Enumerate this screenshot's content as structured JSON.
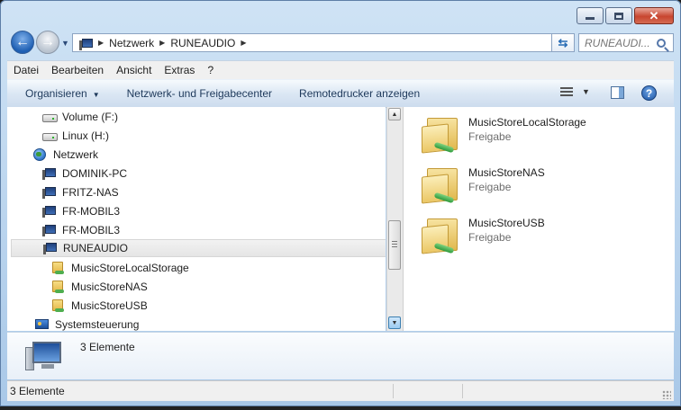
{
  "address": {
    "segments": [
      "Netzwerk",
      "RUNEAUDIO"
    ],
    "search_placeholder": "RUNEAUDI..."
  },
  "menubar": [
    "Datei",
    "Bearbeiten",
    "Ansicht",
    "Extras",
    "?"
  ],
  "toolbar": {
    "organize_label": "Organisieren",
    "network_center_label": "Netzwerk- und Freigabecenter",
    "remote_printers_label": "Remotedrucker anzeigen"
  },
  "tree": {
    "items": [
      {
        "label": "Volume (F:)",
        "icon": "drive-icon"
      },
      {
        "label": "Linux (H:)",
        "icon": "drive-icon"
      },
      {
        "label": "Netzwerk",
        "icon": "network-icon"
      },
      {
        "label": "DOMINIK-PC",
        "icon": "computer-icon"
      },
      {
        "label": "FRITZ-NAS",
        "icon": "computer-icon"
      },
      {
        "label": "FR-MOBIL3",
        "icon": "computer-icon"
      },
      {
        "label": "FR-MOBIL3",
        "icon": "computer-icon"
      },
      {
        "label": "RUNEAUDIO",
        "icon": "computer-icon",
        "selected": true
      },
      {
        "label": "MusicStoreLocalStorage",
        "icon": "shared-folder-icon"
      },
      {
        "label": "MusicStoreNAS",
        "icon": "shared-folder-icon"
      },
      {
        "label": "MusicStoreUSB",
        "icon": "shared-folder-icon"
      },
      {
        "label": "Systemsteuerung",
        "icon": "control-panel-icon"
      }
    ]
  },
  "content": {
    "items": [
      {
        "name": "MusicStoreLocalStorage",
        "type": "Freigabe"
      },
      {
        "name": "MusicStoreNAS",
        "type": "Freigabe"
      },
      {
        "name": "MusicStoreUSB",
        "type": "Freigabe"
      }
    ]
  },
  "details": {
    "count_text": "3 Elemente"
  },
  "status": {
    "count_text": "3 Elemente"
  }
}
